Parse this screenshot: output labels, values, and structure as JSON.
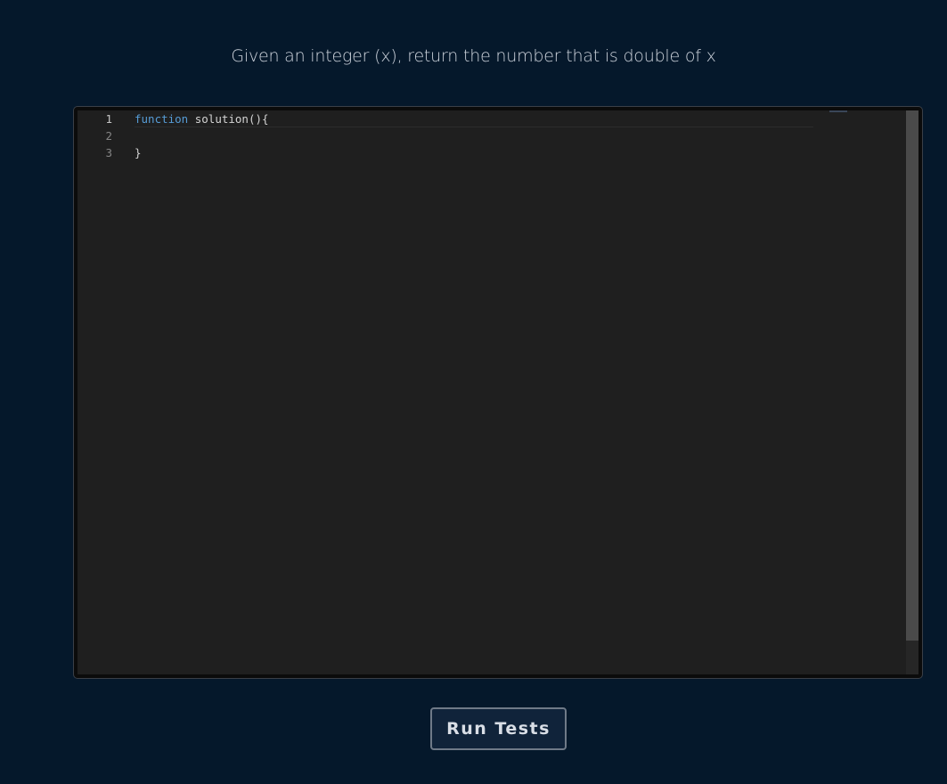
{
  "prompt": {
    "text": "Given an integer (x), return the number that is double of x"
  },
  "editor": {
    "line_numbers": [
      "1",
      "2",
      "3"
    ],
    "lines": [
      {
        "keyword": "function",
        "rest": " solution(){"
      },
      {
        "keyword": "",
        "rest": ""
      },
      {
        "keyword": "",
        "rest": "}"
      }
    ]
  },
  "actions": {
    "run_tests_label": "Run Tests"
  },
  "colors": {
    "page_background": "#05182b",
    "editor_background": "#1f1f1f",
    "keyword": "#569cd6",
    "button_background": "#10233a",
    "button_border": "#6f7a88"
  }
}
